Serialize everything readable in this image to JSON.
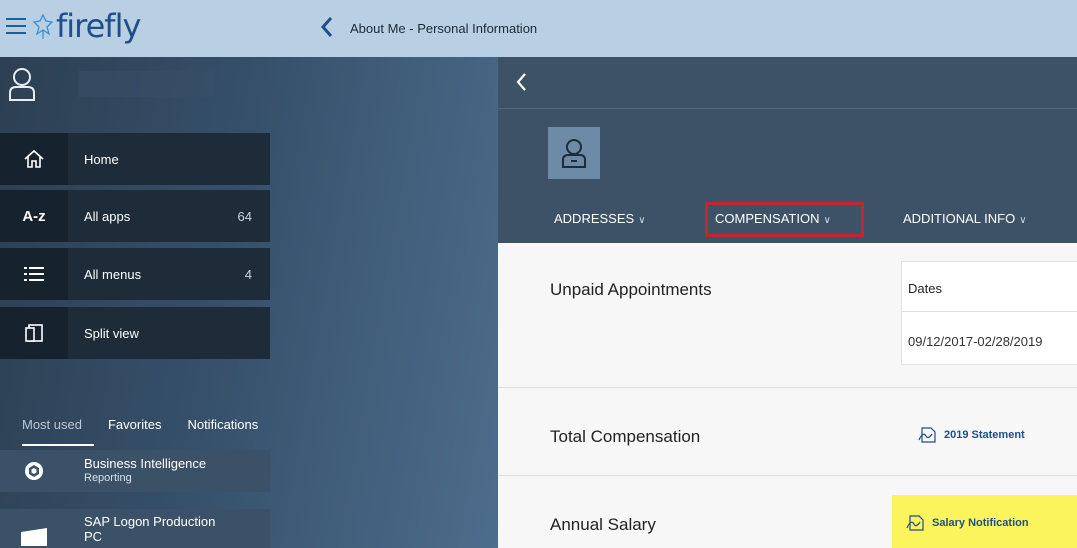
{
  "topbar": {
    "logo_text": "firefly",
    "page_title": "About Me - Personal Information"
  },
  "sidebar": {
    "menu": [
      {
        "label": "Home",
        "count": "",
        "icon": "home-icon"
      },
      {
        "label": "All apps",
        "count": "64",
        "icon": "az-icon"
      },
      {
        "label": "All menus",
        "count": "4",
        "icon": "list-icon"
      },
      {
        "label": "Split view",
        "count": "",
        "icon": "split-view-icon"
      }
    ],
    "az_glyph": "A-z",
    "tabs": [
      "Most used",
      "Favorites",
      "Notifications"
    ],
    "apps": [
      {
        "title": "Business Intelligence",
        "subtitle": "Reporting",
        "icon": "cube-icon"
      },
      {
        "title": "SAP Logon Production",
        "subtitle": "PC",
        "icon": "sap-logon-icon"
      }
    ]
  },
  "main": {
    "section_tabs": [
      "ADDRESSES",
      "COMPENSATION",
      "ADDITIONAL INFO"
    ],
    "rows": {
      "unpaid_label": "Unpaid Appointments",
      "dates_header": "Dates",
      "dates_value": "09/12/2017-02/28/2019",
      "total_label": "Total Compensation",
      "total_link": "2019 Statement",
      "salary_label": "Annual Salary",
      "salary_link": "Salary Notification"
    }
  },
  "colors": {
    "topbar": "#b9cfe3",
    "brand": "#1f4e8a",
    "highlight_box": "#c1272d",
    "highlight_fill": "#fbf45c"
  }
}
